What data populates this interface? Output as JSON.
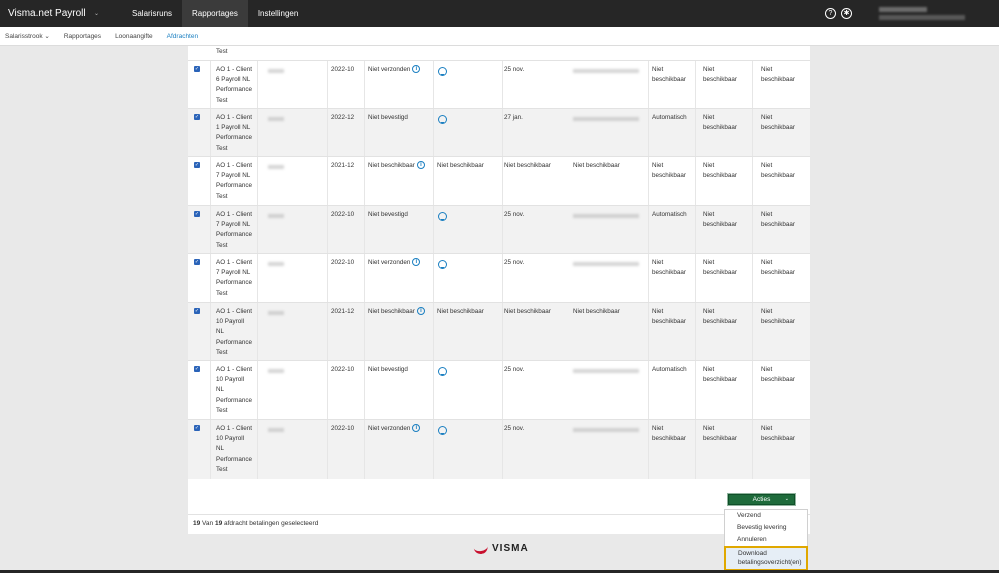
{
  "topbar": {
    "app_title": "Visma.net Payroll",
    "app_caret": "⌄",
    "nav": [
      "Salarisruns",
      "Rapportages",
      "Instellingen"
    ],
    "active_nav": "Rapportages",
    "help_icon": "?",
    "accessibility_icon": "✱"
  },
  "subnav": {
    "items": [
      "Salarisstrook ⌄",
      "Rapportages",
      "Loonaangifte",
      "Afdrachten"
    ],
    "active": "Afdrachten"
  },
  "table": {
    "partial_top_text": "Test",
    "rows": [
      {
        "client": [
          "AO 1 - Client",
          "6 Payroll NL",
          "Performance",
          "Test"
        ],
        "period": "2022-10",
        "status": "Niet verzonden",
        "status_info": true,
        "col5": "",
        "col5_download": true,
        "col6": "25 nov.",
        "col7": "",
        "col7_blur": true,
        "col8": [
          "Niet",
          "beschikbaar"
        ],
        "col9": [
          "Niet",
          "beschikbaar"
        ],
        "col10": [
          "Niet",
          "beschikbaar"
        ]
      },
      {
        "client": [
          "AO 1 - Client",
          "1 Payroll NL",
          "Performance",
          "Test"
        ],
        "period": "2022-12",
        "status": "Niet bevestigd",
        "status_info": false,
        "col5": "",
        "col5_download": true,
        "col6": "27 jan.",
        "col7": "",
        "col7_blur": true,
        "col8": [
          "Automatisch"
        ],
        "col9": [
          "Niet",
          "beschikbaar"
        ],
        "col10": [
          "Niet",
          "beschikbaar"
        ]
      },
      {
        "client": [
          "AO 1 - Client",
          "7 Payroll NL",
          "Performance",
          "Test"
        ],
        "period": "2021-12",
        "status": "Niet beschikbaar",
        "status_info": true,
        "col5": "Niet beschikbaar",
        "col5_download": false,
        "col6": "Niet beschikbaar",
        "col7": "Niet beschikbaar",
        "col7_blur": false,
        "col8": [
          "Niet",
          "beschikbaar"
        ],
        "col9": [
          "Niet",
          "beschikbaar"
        ],
        "col10": [
          "Niet",
          "beschikbaar"
        ]
      },
      {
        "client": [
          "AO 1 - Client",
          "7 Payroll NL",
          "Performance",
          "Test"
        ],
        "period": "2022-10",
        "status": "Niet bevestigd",
        "status_info": false,
        "col5": "",
        "col5_download": true,
        "col6": "25 nov.",
        "col7": "",
        "col7_blur": true,
        "col8": [
          "Automatisch"
        ],
        "col9": [
          "Niet",
          "beschikbaar"
        ],
        "col10": [
          "Niet",
          "beschikbaar"
        ]
      },
      {
        "client": [
          "AO 1 - Client",
          "7 Payroll NL",
          "Performance",
          "Test"
        ],
        "period": "2022-10",
        "status": "Niet verzonden",
        "status_info": true,
        "col5": "",
        "col5_download": true,
        "col6": "25 nov.",
        "col7": "",
        "col7_blur": true,
        "col8": [
          "Niet",
          "beschikbaar"
        ],
        "col9": [
          "Niet",
          "beschikbaar"
        ],
        "col10": [
          "Niet",
          "beschikbaar"
        ]
      },
      {
        "client": [
          "AO 1 - Client",
          "10 Payroll",
          "NL",
          "Performance",
          "Test"
        ],
        "period": "2021-12",
        "status": "Niet beschikbaar",
        "status_info": true,
        "col5": "Niet beschikbaar",
        "col5_download": false,
        "col6": "Niet beschikbaar",
        "col7": "Niet beschikbaar",
        "col7_blur": false,
        "col8": [
          "Niet",
          "beschikbaar"
        ],
        "col9": [
          "Niet",
          "beschikbaar"
        ],
        "col10": [
          "Niet",
          "beschikbaar"
        ]
      },
      {
        "client": [
          "AO 1 - Client",
          "10 Payroll",
          "NL",
          "Performance",
          "Test"
        ],
        "period": "2022-10",
        "status": "Niet bevestigd",
        "status_info": false,
        "col5": "",
        "col5_download": true,
        "col6": "25 nov.",
        "col7": "",
        "col7_blur": true,
        "col8": [
          "Automatisch"
        ],
        "col9": [
          "Niet",
          "beschikbaar"
        ],
        "col10": [
          "Niet",
          "beschikbaar"
        ]
      },
      {
        "client": [
          "AO 1 - Client",
          "10 Payroll",
          "NL",
          "Performance",
          "Test"
        ],
        "period": "2022-10",
        "status": "Niet verzonden",
        "status_info": true,
        "col5": "",
        "col5_download": true,
        "col6": "25 nov.",
        "col7": "",
        "col7_blur": true,
        "col8": [
          "Niet",
          "beschikbaar"
        ],
        "col9": [
          "Niet",
          "beschikbaar"
        ],
        "col10": [
          "Niet",
          "beschikbaar"
        ]
      }
    ]
  },
  "actions": {
    "button_label": "Acties",
    "button_caret": "⌄",
    "menu": [
      "Verzend",
      "Bevestig levering",
      "Annuleren",
      "Download betalingsoverzicht(en)"
    ],
    "highlighted_item": "Download betalingsoverzicht(en)"
  },
  "summary": {
    "selected": "19",
    "of_label": "Van",
    "total": "19",
    "suffix": "afdracht betalingen geselecteerd"
  },
  "footer": {
    "logo_text": "VISMA"
  },
  "colors": {
    "topbar": "#262626",
    "accent": "#1a7fc1",
    "acties_button": "#1e6b3b",
    "highlight_border": "#e0a800",
    "brand_red": "#c8102e"
  }
}
